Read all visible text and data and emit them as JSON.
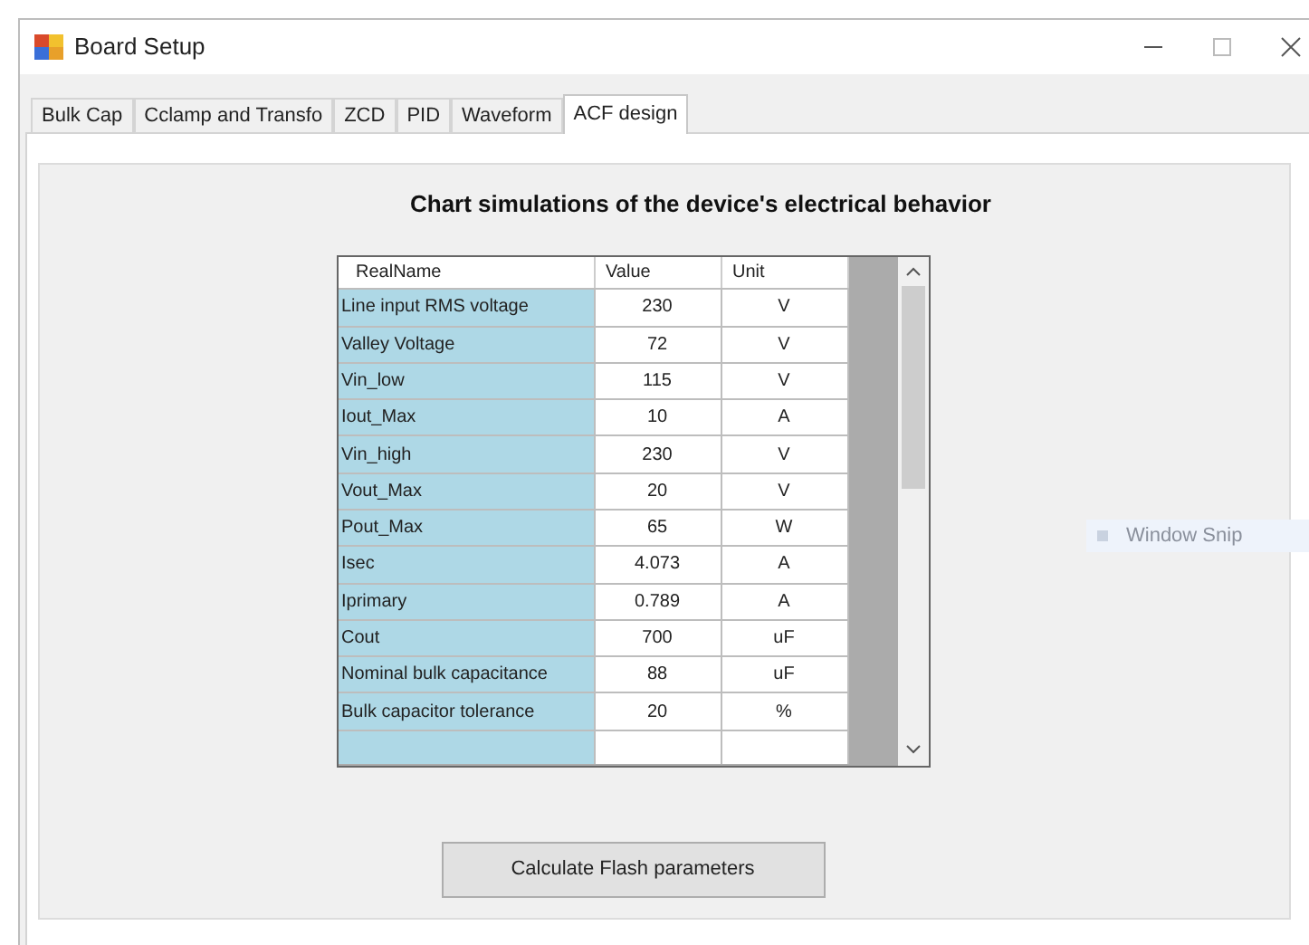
{
  "window": {
    "title": "Board Setup"
  },
  "tabs": [
    {
      "label": "Bulk Cap",
      "selected": false
    },
    {
      "label": "Cclamp and Transfo",
      "selected": false
    },
    {
      "label": "ZCD",
      "selected": false
    },
    {
      "label": "PID",
      "selected": false
    },
    {
      "label": "Waveform",
      "selected": false
    },
    {
      "label": "ACF design",
      "selected": true
    }
  ],
  "heading": "Chart simulations of the device's electrical behavior",
  "table": {
    "columns": [
      "RealName",
      "Value",
      "Unit"
    ],
    "rows": [
      [
        "Line input RMS voltage",
        "230",
        "V"
      ],
      [
        "Valley Voltage",
        "72",
        "V"
      ],
      [
        "Vin_low",
        "115",
        "V"
      ],
      [
        "Iout_Max",
        "10",
        "A"
      ],
      [
        "Vin_high",
        "230",
        "V"
      ],
      [
        "Vout_Max",
        "20",
        "V"
      ],
      [
        "Pout_Max",
        "65",
        "W"
      ],
      [
        "Isec",
        "4.073",
        "A"
      ],
      [
        "Iprimary",
        "0.789",
        "A"
      ],
      [
        "Cout",
        "700",
        "uF"
      ],
      [
        "Nominal bulk capacitance",
        "88",
        "uF"
      ],
      [
        "Bulk capacitor tolerance",
        "20",
        "%"
      ]
    ]
  },
  "button": "Calculate Flash parameters",
  "overlay_tooltip": "Window Snip"
}
